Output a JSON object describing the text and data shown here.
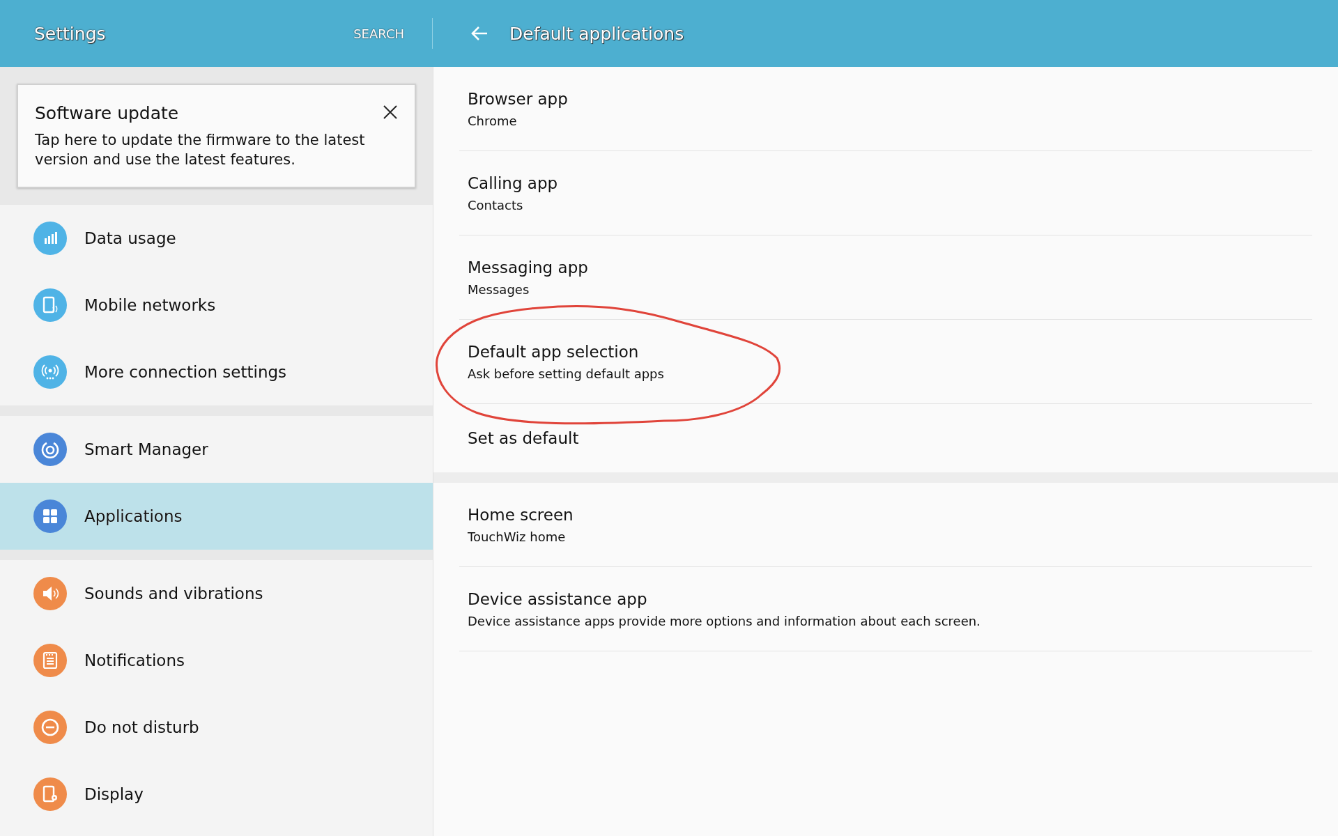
{
  "header": {
    "title": "Settings",
    "search": "SEARCH",
    "page_title": "Default applications"
  },
  "banner": {
    "title": "Software update",
    "text": "Tap here to update the firmware to the latest version and use the latest features."
  },
  "sidebar": {
    "groups": [
      {
        "items": [
          {
            "label": "Data usage",
            "color": "#4fb3e6",
            "selected": false
          },
          {
            "label": "Mobile networks",
            "color": "#4fb3e6",
            "selected": false
          },
          {
            "label": "More connection settings",
            "color": "#4fb3e6",
            "selected": false
          }
        ]
      },
      {
        "items": [
          {
            "label": "Smart Manager",
            "color": "#4a86d8",
            "selected": false
          },
          {
            "label": "Applications",
            "color": "#4a86d8",
            "selected": true
          }
        ]
      },
      {
        "items": [
          {
            "label": "Sounds and vibrations",
            "color": "#ef8b4a",
            "selected": false
          },
          {
            "label": "Notifications",
            "color": "#ef8b4a",
            "selected": false
          },
          {
            "label": "Do not disturb",
            "color": "#ef8b4a",
            "selected": false
          },
          {
            "label": "Display",
            "color": "#ef8b4a",
            "selected": false
          }
        ]
      }
    ]
  },
  "content": {
    "groups": [
      {
        "items": [
          {
            "title": "Browser app",
            "value": "Chrome"
          },
          {
            "title": "Calling app",
            "value": "Contacts"
          },
          {
            "title": "Messaging app",
            "value": "Messages"
          },
          {
            "title": "Default app selection",
            "value": "Ask before setting default apps"
          },
          {
            "title": "Set as default"
          }
        ]
      },
      {
        "items": [
          {
            "title": "Home screen",
            "value": "TouchWiz home"
          },
          {
            "title": "Device assistance app",
            "value": "Device assistance apps provide more options and information about each screen."
          }
        ]
      }
    ]
  }
}
